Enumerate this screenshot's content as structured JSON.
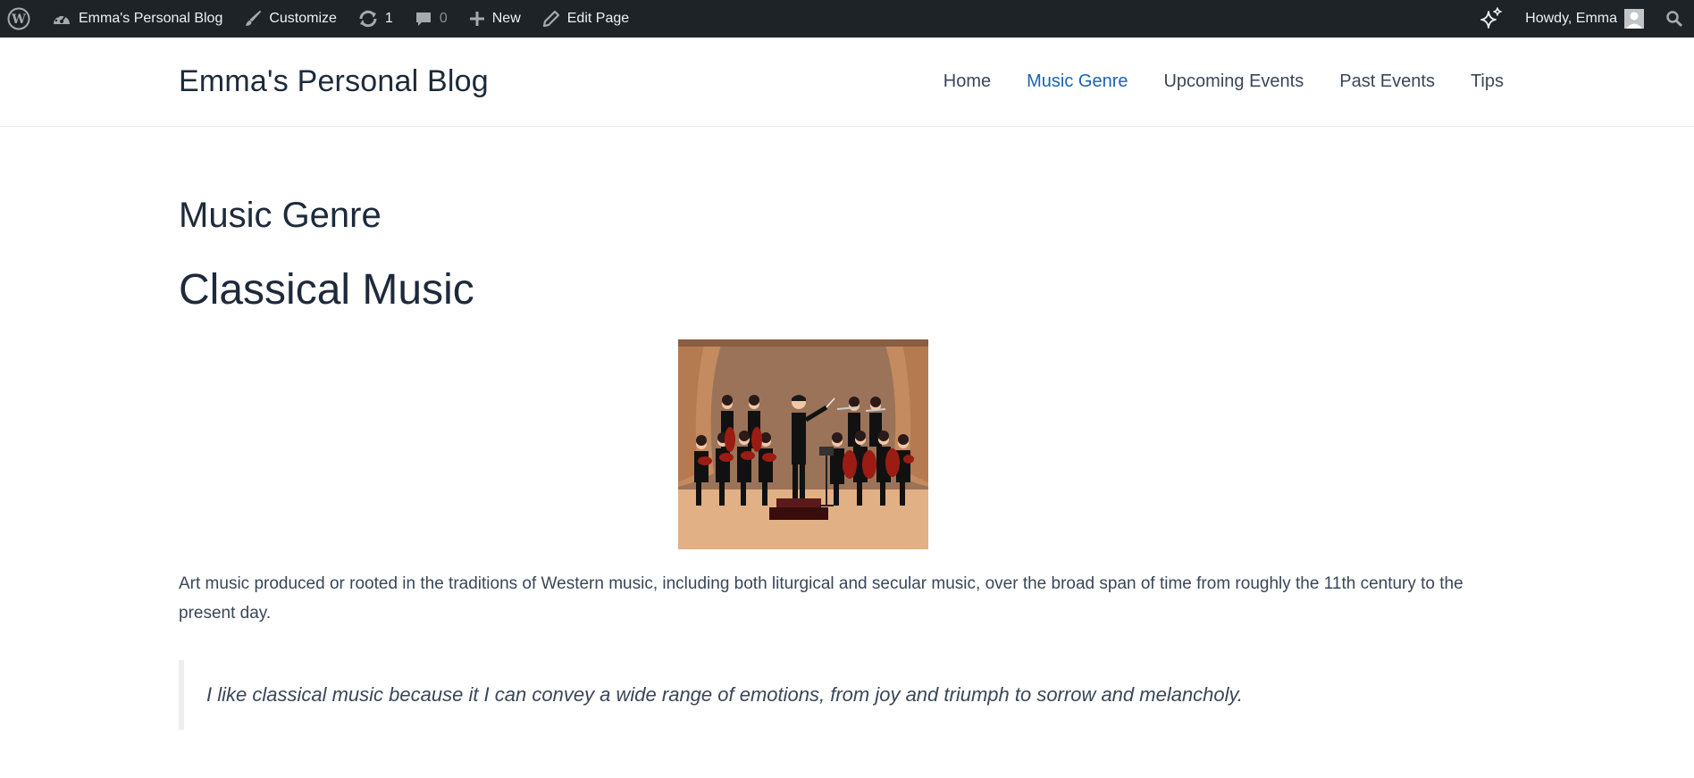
{
  "adminbar": {
    "site_name": "Emma's Personal Blog",
    "customize": "Customize",
    "updates_count": "1",
    "comments_count": "0",
    "new_label": "New",
    "edit_page": "Edit Page",
    "howdy": "Howdy, Emma",
    "icons": [
      "wordpress-icon",
      "dashboard-icon",
      "brush-icon",
      "updates-icon",
      "comments-icon",
      "plus-icon",
      "pencil-icon",
      "sparkle-icon",
      "avatar",
      "search-icon"
    ]
  },
  "header": {
    "site_title": "Emma's Personal Blog",
    "nav": [
      {
        "label": "Home",
        "active": false
      },
      {
        "label": "Music Genre",
        "active": true
      },
      {
        "label": "Upcoming Events",
        "active": false
      },
      {
        "label": "Past Events",
        "active": false
      },
      {
        "label": "Tips",
        "active": false
      }
    ]
  },
  "main": {
    "page_title": "Music Genre",
    "section_heading": "Classical Music",
    "image_alt": "Orchestra with conductor on stage illustration",
    "paragraph": "Art music produced or rooted in the traditions of Western music, including both liturgical and secular music, over the broad span of time from roughly the 11th century to the present day.",
    "quote": "I like classical music because it I can convey a wide range of emotions, from joy and triumph to sorrow and melancholy."
  },
  "colors": {
    "adminbar_bg": "#1d2327",
    "nav_active": "#1a64b4",
    "text": "#1e2a3b"
  }
}
